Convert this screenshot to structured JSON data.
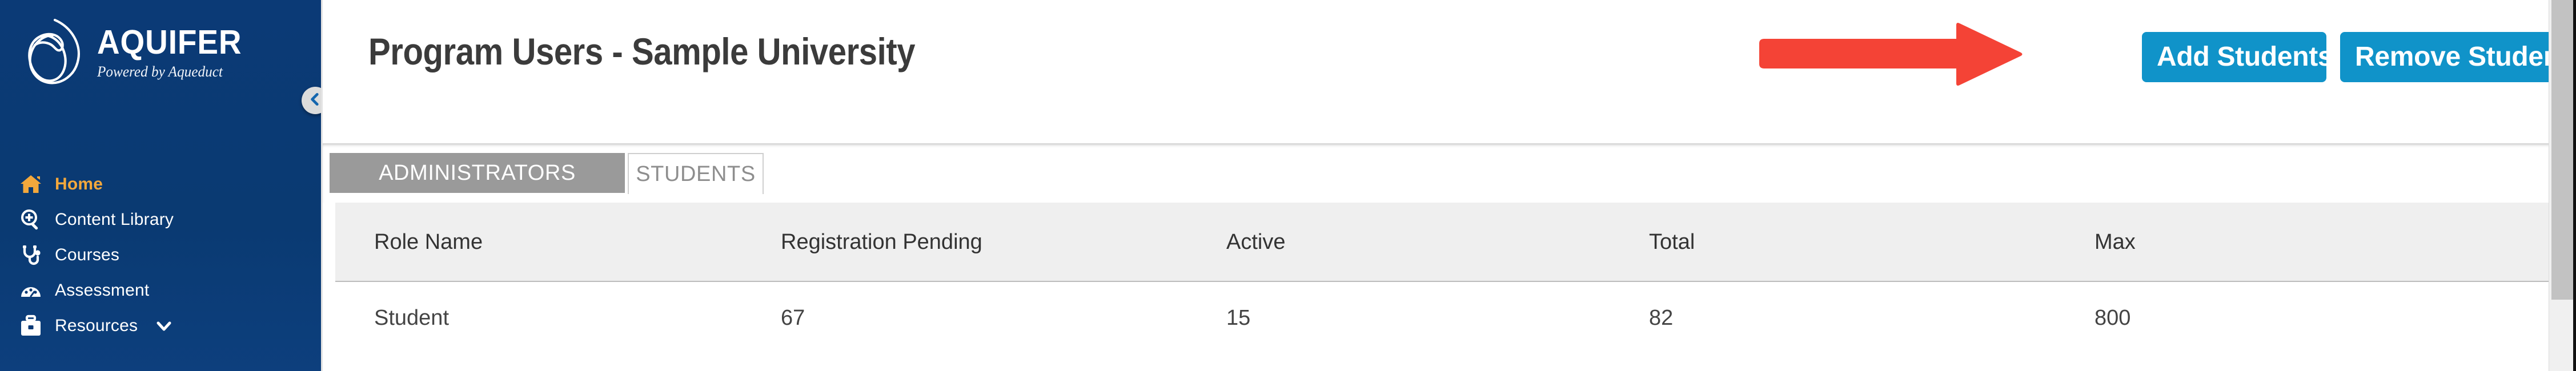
{
  "brand": {
    "name": "AQUIFER",
    "tagline": "Powered by Aqueduct",
    "logo_icon": "aquifer-drop-logo",
    "sidebar_color": "#0b3a76",
    "accent_color": "#f3a83c"
  },
  "sidebar": {
    "collapse_icon": "chevron-left-icon",
    "items": [
      {
        "label": "Home",
        "icon": "home-icon",
        "active": true
      },
      {
        "label": "Content Library",
        "icon": "magnifier-plus-icon",
        "active": false
      },
      {
        "label": "Courses",
        "icon": "stethoscope-icon",
        "active": false
      },
      {
        "label": "Assessment",
        "icon": "gauge-icon",
        "active": false
      },
      {
        "label": "Resources",
        "icon": "briefcase-icon",
        "active": false,
        "caret": "chevron-down-icon"
      }
    ]
  },
  "header": {
    "title": "Program Users - Sample University",
    "buttons": [
      {
        "label": "Add Students",
        "color": "#1093c9"
      },
      {
        "label": "Remove Students",
        "color": "#1093c9"
      }
    ],
    "annotation": {
      "type": "arrow-right",
      "color": "#f44336",
      "points_to": "Add Students"
    }
  },
  "tabs": [
    {
      "label": "ADMINISTRATORS",
      "active": false
    },
    {
      "label": "STUDENTS",
      "active": true
    }
  ],
  "table": {
    "columns": [
      "Role Name",
      "Registration Pending",
      "Active",
      "Total",
      "Max"
    ],
    "rows": [
      [
        "Student",
        "67",
        "15",
        "82",
        "800"
      ]
    ]
  },
  "scrollbar": {
    "orientation": "vertical",
    "thumb_color": "#c2c2c2"
  }
}
